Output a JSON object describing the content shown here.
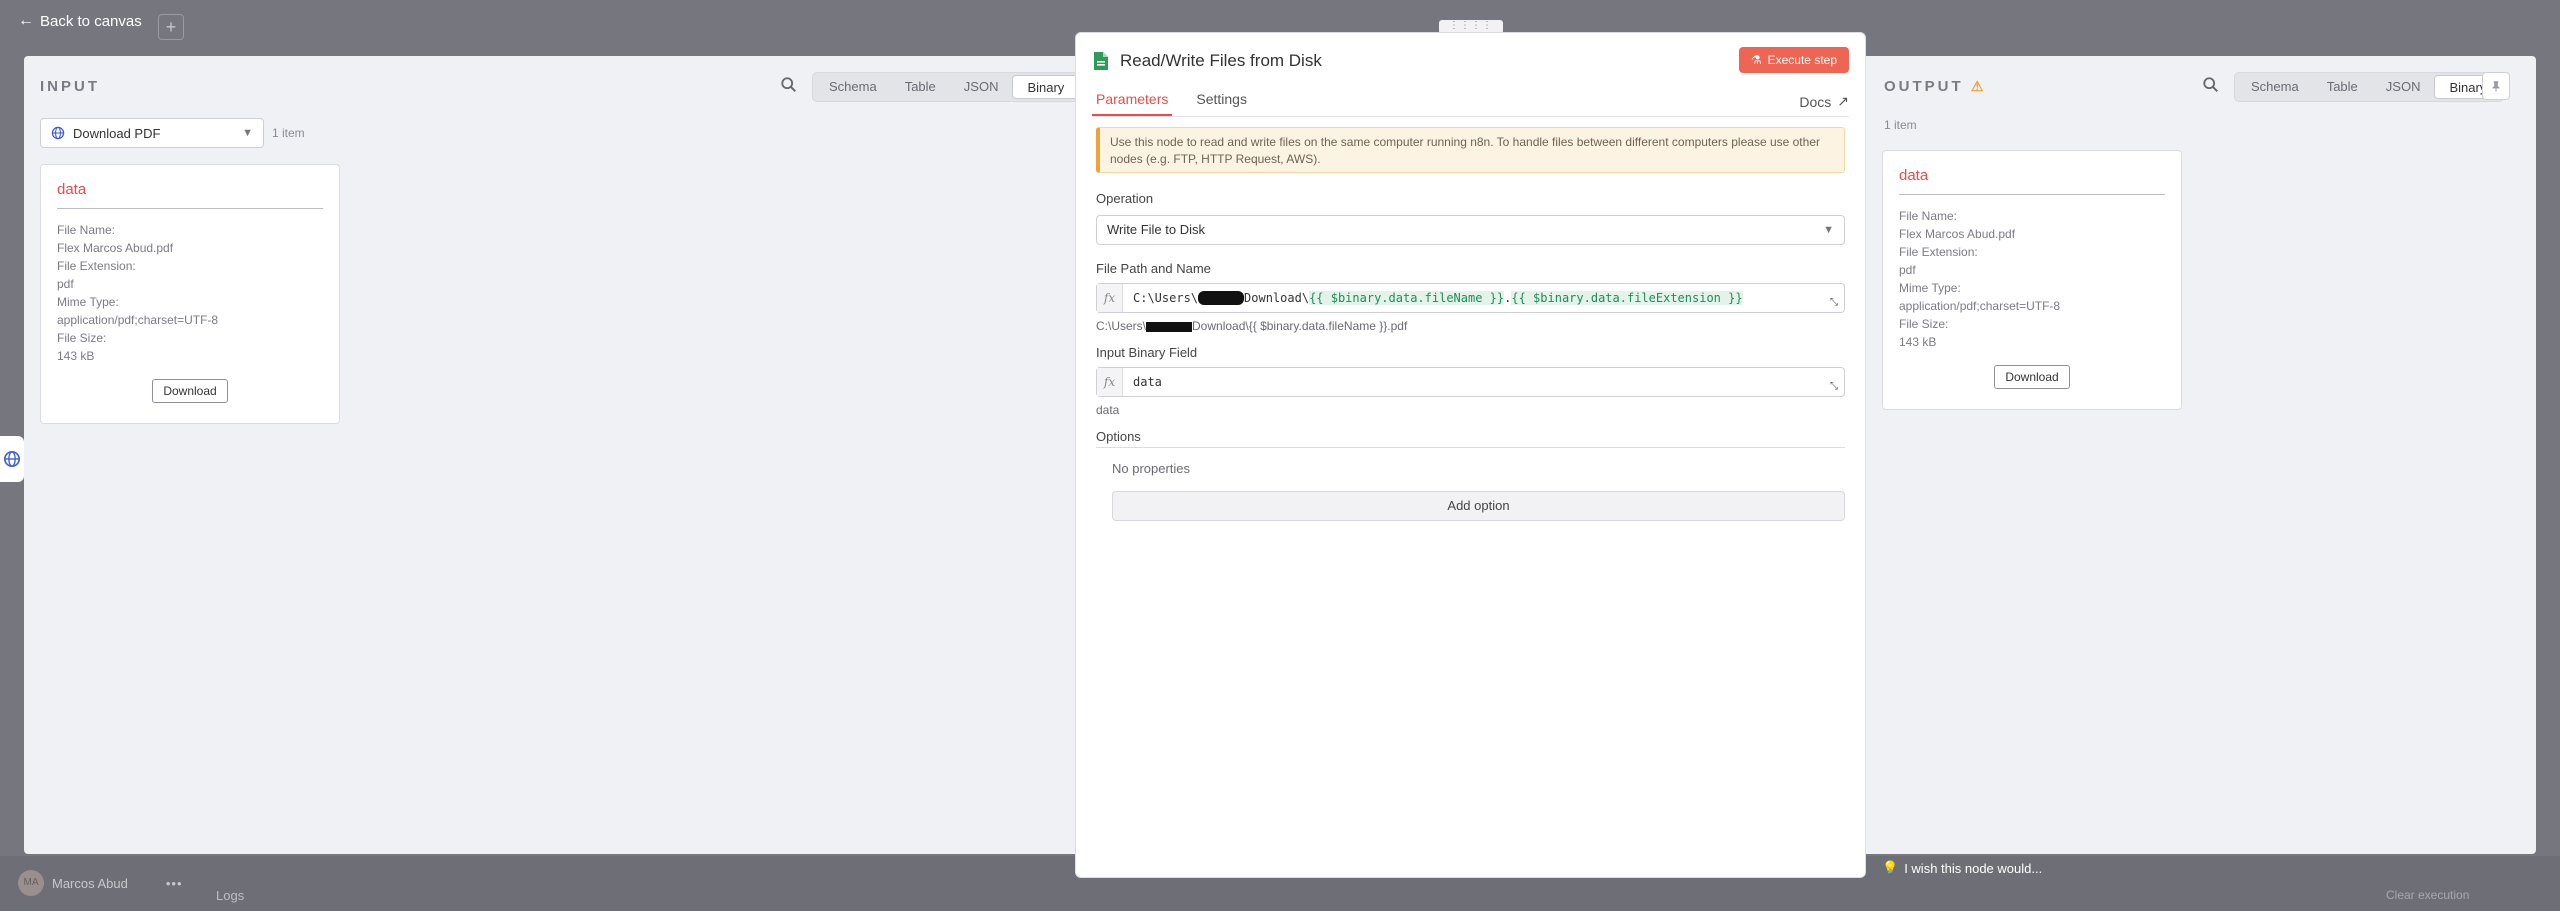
{
  "header": {
    "back_label": "Back to canvas",
    "plus_label": "+"
  },
  "input": {
    "title": "INPUT",
    "views": [
      "Schema",
      "Table",
      "JSON",
      "Binary"
    ],
    "active_view": "Binary",
    "node_select": "Download PDF",
    "item_count": "1 item",
    "card": {
      "name": "data",
      "file_name_label": "File Name:",
      "file_name": "Flex Marcos Abud.pdf",
      "file_ext_label": "File Extension:",
      "file_ext": "pdf",
      "mime_label": "Mime Type:",
      "mime": "application/pdf;charset=UTF-8",
      "size_label": "File Size:",
      "size": "143 kB",
      "download_label": "Download"
    }
  },
  "node": {
    "title": "Read/Write Files from Disk",
    "execute_label": "Execute step",
    "tabs": [
      "Parameters",
      "Settings"
    ],
    "active_tab": "Parameters",
    "docs_label": "Docs",
    "notice": "Use this node to read and write files on the same computer running n8n. To handle files between different computers please use other nodes (e.g. FTP, HTTP Request, AWS).",
    "operation_label": "Operation",
    "operation_value": "Write File to Disk",
    "file_path_label": "File Path and Name",
    "file_path_prefix": "C:\\Users\\",
    "file_path_middle": "Download\\",
    "file_path_expr1": "{{ $binary.data.fileName }}",
    "file_path_dot": ".",
    "file_path_expr2": "{{ $binary.data.fileExtension }}",
    "file_path_hint_prefix": "C:\\Users\\",
    "file_path_hint_suffix": "Download\\{{ $binary.data.fileName }}.pdf",
    "binary_field_label": "Input Binary Field",
    "binary_field_value": "data",
    "binary_field_hint": "data",
    "options_label": "Options",
    "no_properties": "No properties",
    "add_option_label": "Add option",
    "fx_label": "fx"
  },
  "output": {
    "title": "OUTPUT",
    "views": [
      "Schema",
      "Table",
      "JSON",
      "Binary"
    ],
    "active_view": "Binary",
    "item_count": "1 item",
    "card": {
      "name": "data",
      "file_name_label": "File Name:",
      "file_name": "Flex Marcos Abud.pdf",
      "file_ext_label": "File Extension:",
      "file_ext": "pdf",
      "mime_label": "Mime Type:",
      "mime": "application/pdf;charset=UTF-8",
      "size_label": "File Size:",
      "size": "143 kB",
      "download_label": "Download"
    }
  },
  "footer": {
    "user_initials": "MA",
    "user_name": "Marcos Abud",
    "logs_label": "Logs",
    "wish_label": "I wish this node would...",
    "clear_label": "Clear execution"
  },
  "colors": {
    "accent": "#ea4b4b",
    "execute": "#ef6553",
    "warning": "#f0a23a"
  }
}
